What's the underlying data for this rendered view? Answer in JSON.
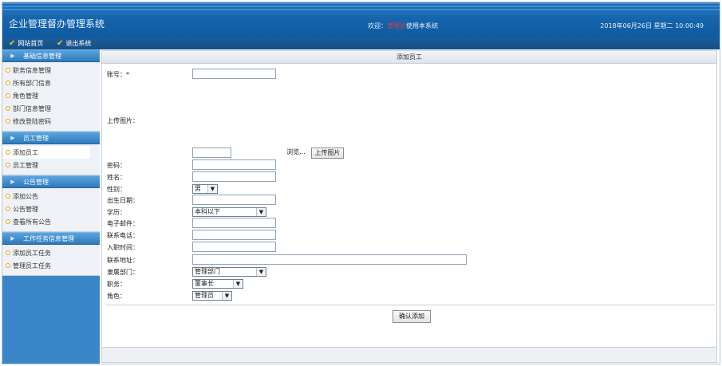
{
  "header": {
    "app_title": "企业管理督办管理系统",
    "welcome_prefix": "欢迎：",
    "welcome_user": "管理员",
    "welcome_suffix": "使用本系统",
    "datetime": "2018年06月26日 星期二 10:00:49"
  },
  "nav": {
    "home": "网站首页",
    "logout": "退出系统"
  },
  "sidebar": {
    "sections": [
      {
        "title": "基础信息管理",
        "items": [
          "职务信息管理",
          "所有部门信息",
          "角色管理",
          "部门信息管理",
          "修改登陆密码"
        ]
      },
      {
        "title": "员工管理",
        "items": [
          "添加员工",
          "员工管理"
        ]
      },
      {
        "title": "公告管理",
        "items": [
          "添加公告",
          "公告管理",
          "查看所有公告"
        ]
      },
      {
        "title": "工作任务信息管理",
        "items": [
          "添加员工任务",
          "管理员工任务"
        ]
      }
    ]
  },
  "form": {
    "panel_title": "添加员工",
    "account_label": "账号：*",
    "upload_label": "上传图片：",
    "browse_button": "浏览...",
    "upload_button": "上传图片",
    "password_label": "密码：",
    "name_label": "姓名：",
    "gender_label": "性别：",
    "gender_value": "男",
    "birth_label": "出生日期：",
    "education_label": "学历：",
    "education_value": "本科以下",
    "email_label": "电子邮件：",
    "phone_label": "联系电话：",
    "hire_label": "入职时间：",
    "address_label": "联系地址：",
    "department_label": "隶属部门：",
    "department_value": "管理部门",
    "position_label": "职务：",
    "position_value": "董事长",
    "role_label": "角色：",
    "role_value": "管理员",
    "submit_button": "确认添加"
  },
  "colors": {
    "header_blue": "#1565ad",
    "sidebar_blue": "#3a86c8",
    "accent_yellow": "#f3c23b",
    "user_red": "#e23b3b"
  }
}
